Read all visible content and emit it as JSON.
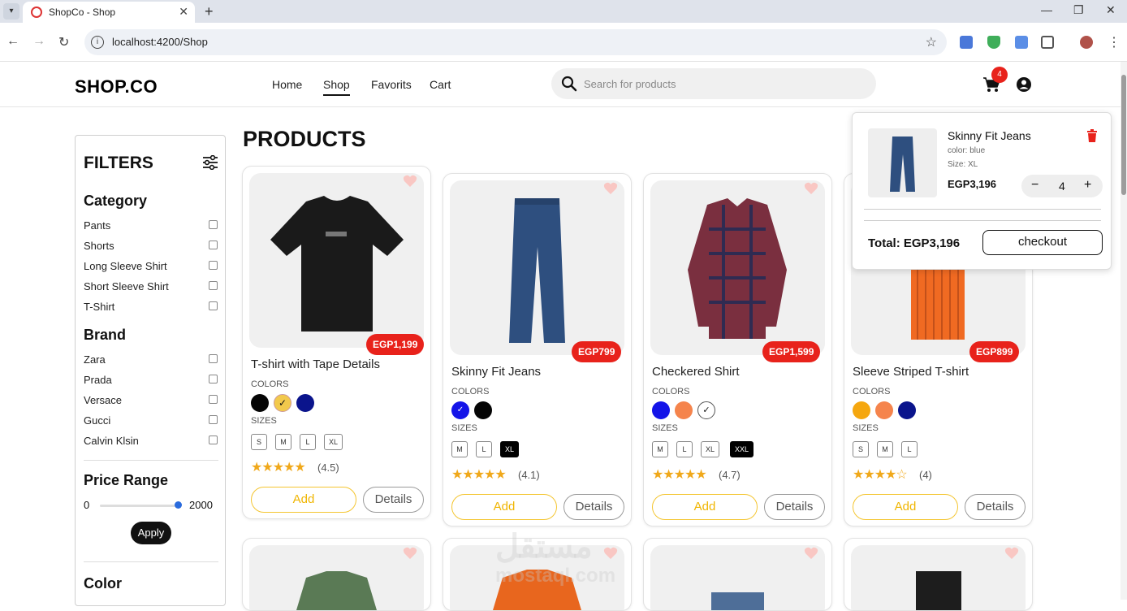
{
  "browser": {
    "tab_title": "ShopCo - Shop",
    "url": "localhost:4200/Shop",
    "new_tab": "+",
    "tab_close": "✕"
  },
  "header": {
    "logo": "SHOP.CO",
    "nav": [
      "Home",
      "Shop",
      "Favorits",
      "Cart"
    ],
    "active_nav": "Shop",
    "search_placeholder": "Search for products",
    "cart_count": "4"
  },
  "filters": {
    "title": "FILTERS",
    "category_title": "Category",
    "categories": [
      "Pants",
      "Shorts",
      "Long Sleeve Shirt",
      "Short Sleeve Shirt",
      "T-Shirt"
    ],
    "brand_title": "Brand",
    "brands": [
      "Zara",
      "Prada",
      "Versace",
      "Gucci",
      "Calvin Klsin"
    ],
    "price_title": "Price Range",
    "price_min": "0",
    "price_max": "2000",
    "apply": "Apply",
    "color_title": "Color"
  },
  "products_title": "PRODUCTS",
  "products": [
    {
      "name": "T-shirt with Tape Details",
      "price": "EGP1,199",
      "colors_label": "COLORS",
      "colors": [
        "#050505",
        "#f2c94c",
        "#0a148c"
      ],
      "sizes_label": "SIZES",
      "sizes": [
        "S",
        "M",
        "L",
        "XL"
      ],
      "selected_size": "",
      "rating": "(4.5)",
      "stars": "★★★★★",
      "add": "Add",
      "details": "Details"
    },
    {
      "name": "Skinny Fit Jeans",
      "price": "EGP799",
      "colors_label": "COLORS",
      "colors": [
        "#1414e8",
        "#050505"
      ],
      "sizes_label": "SIZES",
      "sizes": [
        "M",
        "L",
        "XL"
      ],
      "selected_size": "XL",
      "rating": "(4.1)",
      "stars": "★★★★★",
      "add": "Add",
      "details": "Details"
    },
    {
      "name": "Checkered Shirt",
      "price": "EGP1,599",
      "colors_label": "COLORS",
      "colors": [
        "#1414e8",
        "#f5844c",
        "#ffffff"
      ],
      "sizes_label": "SIZES",
      "sizes": [
        "M",
        "L",
        "XL",
        "XXL"
      ],
      "selected_size": "XXL",
      "rating": "(4.7)",
      "stars": "★★★★★",
      "add": "Add",
      "details": "Details"
    },
    {
      "name": "Sleeve Striped T-shirt",
      "price": "EGP899",
      "colors_label": "COLORS",
      "colors": [
        "#f5a70f",
        "#f5844c",
        "#0a148c"
      ],
      "sizes_label": "SIZES",
      "sizes": [
        "S",
        "M",
        "L"
      ],
      "selected_size": "",
      "rating": "(4)",
      "stars": "★★★★☆",
      "add": "Add",
      "details": "Details"
    }
  ],
  "cart_popup": {
    "item_name": "Skinny Fit Jeans",
    "item_color": "color: blue",
    "item_size": "Size: XL",
    "item_price": "EGP3,196",
    "quantity": "4",
    "minus": "−",
    "plus": "+",
    "total": "Total: EGP3,196",
    "checkout": "checkout"
  },
  "watermark": "مستقل",
  "watermark_sub": "mostaql.com"
}
